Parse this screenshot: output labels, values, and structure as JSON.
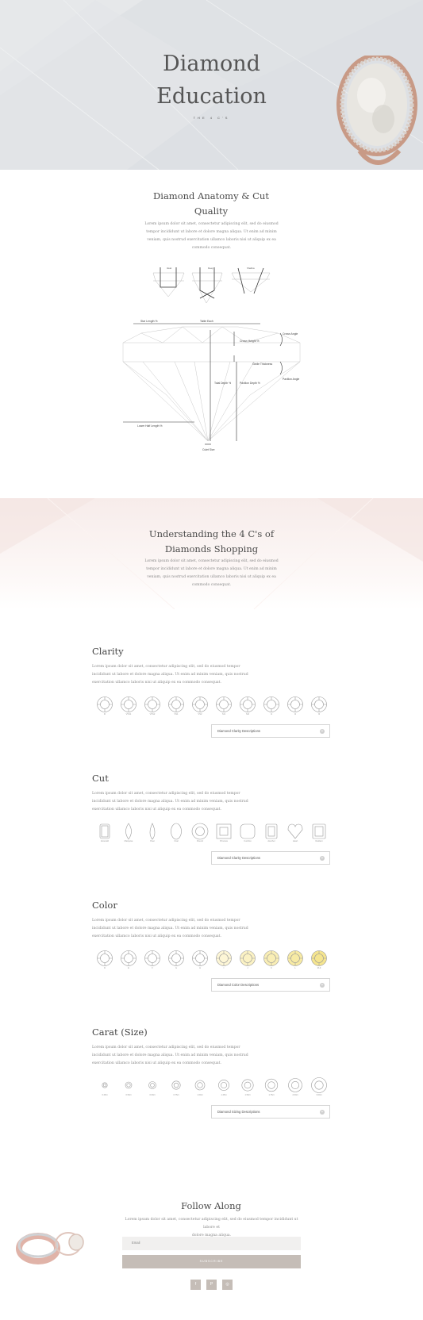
{
  "hero": {
    "title_line1": "Diamond",
    "title_line2": "Education",
    "subtitle": "THE 4 C'S"
  },
  "anatomy": {
    "title_line1": "Diamond Anatomy & Cut",
    "title_line2": "Quality",
    "body": [
      "Lorem ipsum dolor sit amet, consectetur adipiscing elit, sed do eiusmod",
      "tempor incididunt ut labore et dolore magna aliqua. Ut enim ad minim",
      "veniam, quis nostrud exercitation ullamco laboris nisi ut aliquip ex ea",
      "commodo consequat."
    ],
    "cut_labels": [
      "Ideal",
      "Deep",
      "Shallow"
    ],
    "diagram_labels": {
      "star_length": "Star Length %",
      "table_each": "Table Each",
      "crown_height": "Crown Height %",
      "crown_angle": "Crown Angle",
      "girdle_thickness": "Girdle Thickness",
      "total_depth": "Total Depth %",
      "pavilion_depth": "Pavilion Depth %",
      "pavilion_angle": "Pavilion Angle",
      "lower_half_length": "Lower Half Length %",
      "culet_size": "Culet Size"
    }
  },
  "four_cs": {
    "title_line1": "Understanding the 4 C's of",
    "title_line2": "Diamonds Shopping",
    "body": [
      "Lorem ipsum dolor sit amet, consectetur adipiscing elit, sed do eiusmod",
      "tempor incididunt ut labore et dolore magna aliqua. Ut enim ad minim",
      "veniam, quis nostrud exercitation ullamco laboris nisi ut aliquip ex ea",
      "commodo consequat."
    ]
  },
  "sections": [
    {
      "title": "Clarity",
      "body": [
        "Lorem ipsum dolor sit amet, consectetur adipiscing elit, sed do eiusmod tempor",
        "incididunt ut labore et dolore magna aliqua. Ut enim ad minim veniam, quis nostrud",
        "exercitation ullamco laboris nisi ut aliquip ex ea commodo consequat."
      ],
      "items": [
        "FI",
        "VVS1",
        "VVS2",
        "VS1",
        "VS2",
        "SI1",
        "SI2",
        "I1",
        "I2",
        "I3"
      ],
      "accordion": "Diamond Clarity Descriptions"
    },
    {
      "title": "Cut",
      "body": [
        "Lorem ipsum dolor sit amet, consectetur adipiscing elit, sed do eiusmod tempor",
        "incididunt ut labore et dolore magna aliqua. Ut enim ad minim veniam, quis nostrud",
        "exercitation ullamco laboris nisi ut aliquip ex ea commodo consequat."
      ],
      "items": [
        "Emerald",
        "Marquise",
        "Pear",
        "Oval",
        "Round",
        "Princess",
        "Cushion",
        "Asscher",
        "Heart",
        "Radiant"
      ],
      "accordion": "Diamond Clarity Descriptions"
    },
    {
      "title": "Color",
      "body": [
        "Lorem ipsum dolor sit amet, consectetur adipiscing elit, sed do eiusmod tempor",
        "incididunt ut labore et dolore magna aliqua. Ut enim ad minim veniam, quis nostrud",
        "exercitation ullamco laboris nisi ut aliquip ex ea commodo consequat."
      ],
      "items": [
        "D",
        "E",
        "F",
        "G",
        "H",
        "I",
        "J",
        "K",
        "L",
        "M-Z"
      ],
      "accordion": "Diamond Color Descriptions"
    },
    {
      "title": "Carat (Size)",
      "body": [
        "Lorem ipsum dolor sit amet, consectetur adipiscing elit, sed do eiusmod tempor",
        "incididunt ut labore et dolore magna aliqua. Ut enim ad minim veniam, quis nostrud",
        "exercitation ullamco laboris nisi ut aliquip ex ea commodo consequat."
      ],
      "items": [
        "0.25ct",
        "0.50ct",
        "0.60ct",
        "0.75ct",
        "1.00ct",
        "1.25ct",
        "1.50ct",
        "1.75ct",
        "2.00ct",
        "3.00ct"
      ],
      "accordion": "Diamond Sizing Descriptions"
    }
  ],
  "follow": {
    "title": "Follow Along",
    "body": [
      "Lorem ipsum dolor sit amet, consectetur adipiscing elit, sed do eiusmod tempor incididunt ut labore et",
      "dolore magna aliqua."
    ],
    "email_placeholder": "Email",
    "subscribe_label": "SUBSCRIBE",
    "social": [
      "f",
      "P",
      "◎"
    ]
  },
  "colors": {
    "accent": "#c5bdb7",
    "diamond_tints": [
      "#ffffff",
      "#ffffff",
      "#ffffff",
      "#ffffff",
      "#ffffff",
      "#fdf6d6",
      "#fbf2c4",
      "#f9eeb5",
      "#f7eaa4",
      "#f5e58f"
    ]
  }
}
